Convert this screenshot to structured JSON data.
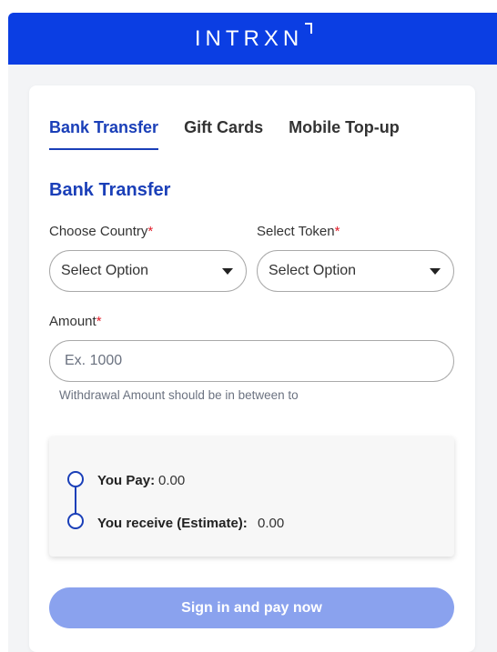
{
  "header": {
    "logo_text": "INTRXN",
    "background": "#0b3ee3"
  },
  "tabs": [
    {
      "label": "Bank Transfer",
      "active": true
    },
    {
      "label": "Gift Cards",
      "active": false
    },
    {
      "label": "Mobile Top-up",
      "active": false
    }
  ],
  "section_title": "Bank Transfer",
  "form": {
    "country": {
      "label": "Choose Country",
      "required_mark": "*",
      "value": "Select Option"
    },
    "token": {
      "label": "Select Token",
      "required_mark": "*",
      "value": "Select Option"
    },
    "amount": {
      "label": "Amount",
      "required_mark": "*",
      "placeholder": "Ex. 1000",
      "value": ""
    },
    "hint": "Withdrawal Amount should be in between to"
  },
  "summary": {
    "pay_label": "You Pay:",
    "pay_value": "0.00",
    "receive_label": "You receive (Estimate):",
    "receive_value": "0.00"
  },
  "submit": {
    "label": "Sign in and pay now",
    "color": "#8aa2ee"
  },
  "colors": {
    "accent": "#1a3fb8",
    "required": "#e11d2a"
  }
}
